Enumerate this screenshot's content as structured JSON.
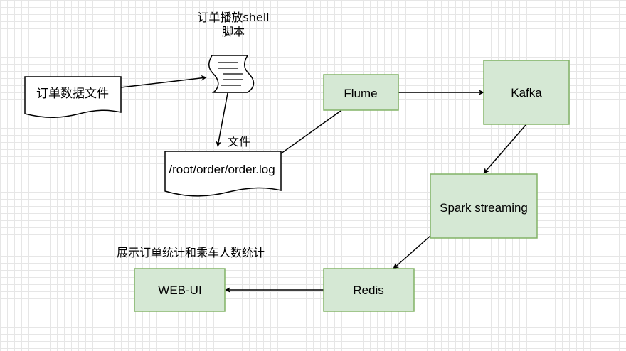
{
  "diagram": {
    "colors": {
      "process_fill": "#d5e8d4",
      "process_stroke": "#82b366",
      "edge": "#000000",
      "grid": "#e6e6e6"
    },
    "nodes": {
      "order_data_file": "订单数据文件",
      "shell_script_icon": "shell-script-icon",
      "shell_script_label_line1": "订单播放shell",
      "shell_script_label_line2": "脚本",
      "file_label": "文件",
      "order_log": "/root/order/order.log",
      "flume": "Flume",
      "kafka": "Kafka",
      "spark": "Spark streaming",
      "redis": "Redis",
      "webui": "WEB-UI",
      "display_label": "展示订单统计和乘车人数统计"
    }
  }
}
